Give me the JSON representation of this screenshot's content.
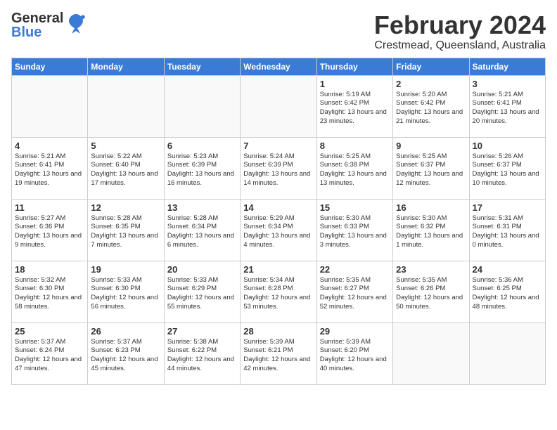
{
  "header": {
    "logo_general": "General",
    "logo_blue": "Blue",
    "month_title": "February 2024",
    "location": "Crestmead, Queensland, Australia"
  },
  "days_of_week": [
    "Sunday",
    "Monday",
    "Tuesday",
    "Wednesday",
    "Thursday",
    "Friday",
    "Saturday"
  ],
  "weeks": [
    [
      {
        "day": "",
        "info": ""
      },
      {
        "day": "",
        "info": ""
      },
      {
        "day": "",
        "info": ""
      },
      {
        "day": "",
        "info": ""
      },
      {
        "day": "1",
        "info": "Sunrise: 5:19 AM\nSunset: 6:42 PM\nDaylight: 13 hours\nand 23 minutes."
      },
      {
        "day": "2",
        "info": "Sunrise: 5:20 AM\nSunset: 6:42 PM\nDaylight: 13 hours\nand 21 minutes."
      },
      {
        "day": "3",
        "info": "Sunrise: 5:21 AM\nSunset: 6:41 PM\nDaylight: 13 hours\nand 20 minutes."
      }
    ],
    [
      {
        "day": "4",
        "info": "Sunrise: 5:21 AM\nSunset: 6:41 PM\nDaylight: 13 hours\nand 19 minutes."
      },
      {
        "day": "5",
        "info": "Sunrise: 5:22 AM\nSunset: 6:40 PM\nDaylight: 13 hours\nand 17 minutes."
      },
      {
        "day": "6",
        "info": "Sunrise: 5:23 AM\nSunset: 6:39 PM\nDaylight: 13 hours\nand 16 minutes."
      },
      {
        "day": "7",
        "info": "Sunrise: 5:24 AM\nSunset: 6:39 PM\nDaylight: 13 hours\nand 14 minutes."
      },
      {
        "day": "8",
        "info": "Sunrise: 5:25 AM\nSunset: 6:38 PM\nDaylight: 13 hours\nand 13 minutes."
      },
      {
        "day": "9",
        "info": "Sunrise: 5:25 AM\nSunset: 6:37 PM\nDaylight: 13 hours\nand 12 minutes."
      },
      {
        "day": "10",
        "info": "Sunrise: 5:26 AM\nSunset: 6:37 PM\nDaylight: 13 hours\nand 10 minutes."
      }
    ],
    [
      {
        "day": "11",
        "info": "Sunrise: 5:27 AM\nSunset: 6:36 PM\nDaylight: 13 hours\nand 9 minutes."
      },
      {
        "day": "12",
        "info": "Sunrise: 5:28 AM\nSunset: 6:35 PM\nDaylight: 13 hours\nand 7 minutes."
      },
      {
        "day": "13",
        "info": "Sunrise: 5:28 AM\nSunset: 6:34 PM\nDaylight: 13 hours\nand 6 minutes."
      },
      {
        "day": "14",
        "info": "Sunrise: 5:29 AM\nSunset: 6:34 PM\nDaylight: 13 hours\nand 4 minutes."
      },
      {
        "day": "15",
        "info": "Sunrise: 5:30 AM\nSunset: 6:33 PM\nDaylight: 13 hours\nand 3 minutes."
      },
      {
        "day": "16",
        "info": "Sunrise: 5:30 AM\nSunset: 6:32 PM\nDaylight: 13 hours\nand 1 minute."
      },
      {
        "day": "17",
        "info": "Sunrise: 5:31 AM\nSunset: 6:31 PM\nDaylight: 13 hours\nand 0 minutes."
      }
    ],
    [
      {
        "day": "18",
        "info": "Sunrise: 5:32 AM\nSunset: 6:30 PM\nDaylight: 12 hours\nand 58 minutes."
      },
      {
        "day": "19",
        "info": "Sunrise: 5:33 AM\nSunset: 6:30 PM\nDaylight: 12 hours\nand 56 minutes."
      },
      {
        "day": "20",
        "info": "Sunrise: 5:33 AM\nSunset: 6:29 PM\nDaylight: 12 hours\nand 55 minutes."
      },
      {
        "day": "21",
        "info": "Sunrise: 5:34 AM\nSunset: 6:28 PM\nDaylight: 12 hours\nand 53 minutes."
      },
      {
        "day": "22",
        "info": "Sunrise: 5:35 AM\nSunset: 6:27 PM\nDaylight: 12 hours\nand 52 minutes."
      },
      {
        "day": "23",
        "info": "Sunrise: 5:35 AM\nSunset: 6:26 PM\nDaylight: 12 hours\nand 50 minutes."
      },
      {
        "day": "24",
        "info": "Sunrise: 5:36 AM\nSunset: 6:25 PM\nDaylight: 12 hours\nand 48 minutes."
      }
    ],
    [
      {
        "day": "25",
        "info": "Sunrise: 5:37 AM\nSunset: 6:24 PM\nDaylight: 12 hours\nand 47 minutes."
      },
      {
        "day": "26",
        "info": "Sunrise: 5:37 AM\nSunset: 6:23 PM\nDaylight: 12 hours\nand 45 minutes."
      },
      {
        "day": "27",
        "info": "Sunrise: 5:38 AM\nSunset: 6:22 PM\nDaylight: 12 hours\nand 44 minutes."
      },
      {
        "day": "28",
        "info": "Sunrise: 5:39 AM\nSunset: 6:21 PM\nDaylight: 12 hours\nand 42 minutes."
      },
      {
        "day": "29",
        "info": "Sunrise: 5:39 AM\nSunset: 6:20 PM\nDaylight: 12 hours\nand 40 minutes."
      },
      {
        "day": "",
        "info": ""
      },
      {
        "day": "",
        "info": ""
      }
    ]
  ]
}
